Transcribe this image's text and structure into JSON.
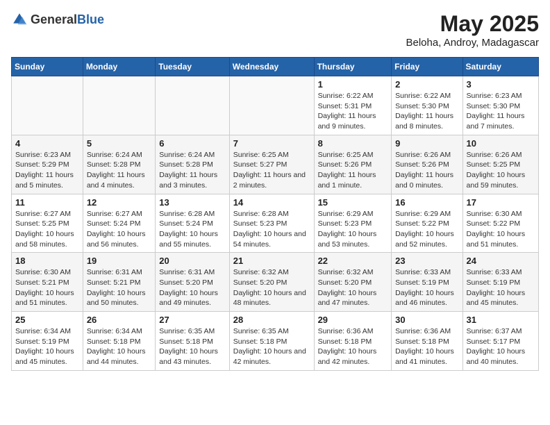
{
  "header": {
    "logo_general": "General",
    "logo_blue": "Blue",
    "title": "May 2025",
    "subtitle": "Beloha, Androy, Madagascar"
  },
  "calendar": {
    "days_of_week": [
      "Sunday",
      "Monday",
      "Tuesday",
      "Wednesday",
      "Thursday",
      "Friday",
      "Saturday"
    ],
    "weeks": [
      [
        {
          "day": "",
          "info": ""
        },
        {
          "day": "",
          "info": ""
        },
        {
          "day": "",
          "info": ""
        },
        {
          "day": "",
          "info": ""
        },
        {
          "day": "1",
          "info": "Sunrise: 6:22 AM\nSunset: 5:31 PM\nDaylight: 11 hours and 9 minutes."
        },
        {
          "day": "2",
          "info": "Sunrise: 6:22 AM\nSunset: 5:30 PM\nDaylight: 11 hours and 8 minutes."
        },
        {
          "day": "3",
          "info": "Sunrise: 6:23 AM\nSunset: 5:30 PM\nDaylight: 11 hours and 7 minutes."
        }
      ],
      [
        {
          "day": "4",
          "info": "Sunrise: 6:23 AM\nSunset: 5:29 PM\nDaylight: 11 hours and 5 minutes."
        },
        {
          "day": "5",
          "info": "Sunrise: 6:24 AM\nSunset: 5:28 PM\nDaylight: 11 hours and 4 minutes."
        },
        {
          "day": "6",
          "info": "Sunrise: 6:24 AM\nSunset: 5:28 PM\nDaylight: 11 hours and 3 minutes."
        },
        {
          "day": "7",
          "info": "Sunrise: 6:25 AM\nSunset: 5:27 PM\nDaylight: 11 hours and 2 minutes."
        },
        {
          "day": "8",
          "info": "Sunrise: 6:25 AM\nSunset: 5:26 PM\nDaylight: 11 hours and 1 minute."
        },
        {
          "day": "9",
          "info": "Sunrise: 6:26 AM\nSunset: 5:26 PM\nDaylight: 11 hours and 0 minutes."
        },
        {
          "day": "10",
          "info": "Sunrise: 6:26 AM\nSunset: 5:25 PM\nDaylight: 10 hours and 59 minutes."
        }
      ],
      [
        {
          "day": "11",
          "info": "Sunrise: 6:27 AM\nSunset: 5:25 PM\nDaylight: 10 hours and 58 minutes."
        },
        {
          "day": "12",
          "info": "Sunrise: 6:27 AM\nSunset: 5:24 PM\nDaylight: 10 hours and 56 minutes."
        },
        {
          "day": "13",
          "info": "Sunrise: 6:28 AM\nSunset: 5:24 PM\nDaylight: 10 hours and 55 minutes."
        },
        {
          "day": "14",
          "info": "Sunrise: 6:28 AM\nSunset: 5:23 PM\nDaylight: 10 hours and 54 minutes."
        },
        {
          "day": "15",
          "info": "Sunrise: 6:29 AM\nSunset: 5:23 PM\nDaylight: 10 hours and 53 minutes."
        },
        {
          "day": "16",
          "info": "Sunrise: 6:29 AM\nSunset: 5:22 PM\nDaylight: 10 hours and 52 minutes."
        },
        {
          "day": "17",
          "info": "Sunrise: 6:30 AM\nSunset: 5:22 PM\nDaylight: 10 hours and 51 minutes."
        }
      ],
      [
        {
          "day": "18",
          "info": "Sunrise: 6:30 AM\nSunset: 5:21 PM\nDaylight: 10 hours and 51 minutes."
        },
        {
          "day": "19",
          "info": "Sunrise: 6:31 AM\nSunset: 5:21 PM\nDaylight: 10 hours and 50 minutes."
        },
        {
          "day": "20",
          "info": "Sunrise: 6:31 AM\nSunset: 5:20 PM\nDaylight: 10 hours and 49 minutes."
        },
        {
          "day": "21",
          "info": "Sunrise: 6:32 AM\nSunset: 5:20 PM\nDaylight: 10 hours and 48 minutes."
        },
        {
          "day": "22",
          "info": "Sunrise: 6:32 AM\nSunset: 5:20 PM\nDaylight: 10 hours and 47 minutes."
        },
        {
          "day": "23",
          "info": "Sunrise: 6:33 AM\nSunset: 5:19 PM\nDaylight: 10 hours and 46 minutes."
        },
        {
          "day": "24",
          "info": "Sunrise: 6:33 AM\nSunset: 5:19 PM\nDaylight: 10 hours and 45 minutes."
        }
      ],
      [
        {
          "day": "25",
          "info": "Sunrise: 6:34 AM\nSunset: 5:19 PM\nDaylight: 10 hours and 45 minutes."
        },
        {
          "day": "26",
          "info": "Sunrise: 6:34 AM\nSunset: 5:18 PM\nDaylight: 10 hours and 44 minutes."
        },
        {
          "day": "27",
          "info": "Sunrise: 6:35 AM\nSunset: 5:18 PM\nDaylight: 10 hours and 43 minutes."
        },
        {
          "day": "28",
          "info": "Sunrise: 6:35 AM\nSunset: 5:18 PM\nDaylight: 10 hours and 42 minutes."
        },
        {
          "day": "29",
          "info": "Sunrise: 6:36 AM\nSunset: 5:18 PM\nDaylight: 10 hours and 42 minutes."
        },
        {
          "day": "30",
          "info": "Sunrise: 6:36 AM\nSunset: 5:18 PM\nDaylight: 10 hours and 41 minutes."
        },
        {
          "day": "31",
          "info": "Sunrise: 6:37 AM\nSunset: 5:17 PM\nDaylight: 10 hours and 40 minutes."
        }
      ]
    ]
  }
}
